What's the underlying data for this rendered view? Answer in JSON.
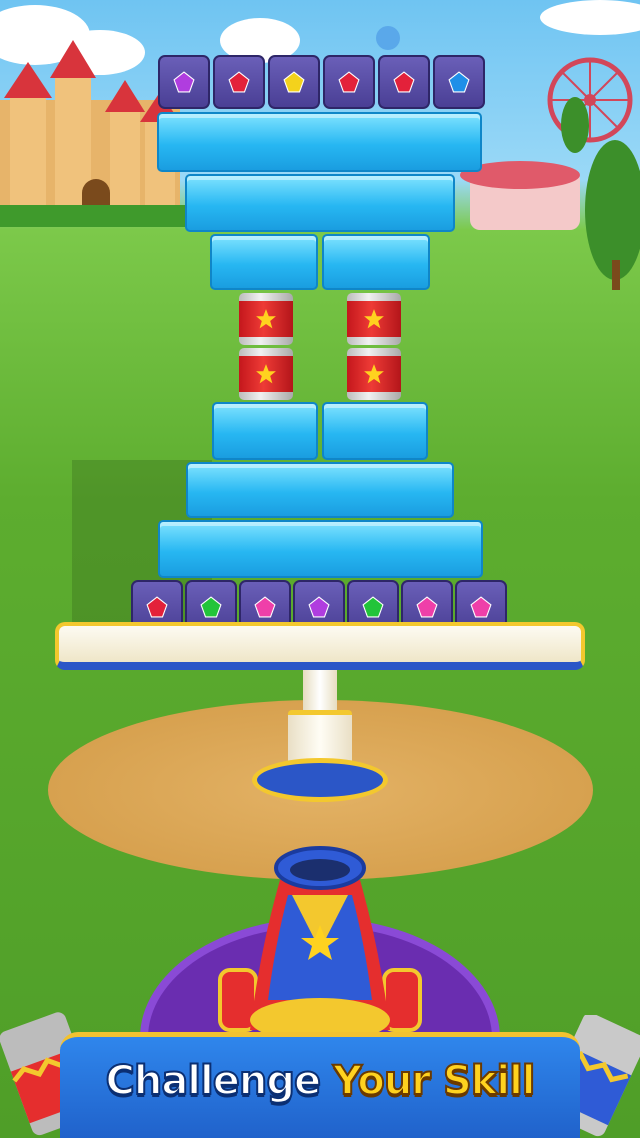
{
  "banner": {
    "word_white": "Challenge",
    "word_yellow": "Your Skill"
  },
  "colors": {
    "sky": "#7fcdf4",
    "grass": "#5aaa2e",
    "ice": "#2bb8f2",
    "gem_block": "#5a4fb0",
    "banner_blue": "#2a78e4",
    "banner_gold": "#f2c230"
  },
  "tower": {
    "top_gem_row": [
      "purple-gem",
      "red-gem",
      "yellow-gem",
      "red-gem",
      "red-gem",
      "blue-gem"
    ],
    "bottom_gem_row": [
      "red-gem",
      "green-gem",
      "pink-gem",
      "purple-gem",
      "green-gem",
      "pink-gem",
      "pink-gem"
    ]
  },
  "icons": [
    "star-icon",
    "gem-icon",
    "cannon-icon",
    "castle-icon",
    "ferris-wheel-icon"
  ]
}
